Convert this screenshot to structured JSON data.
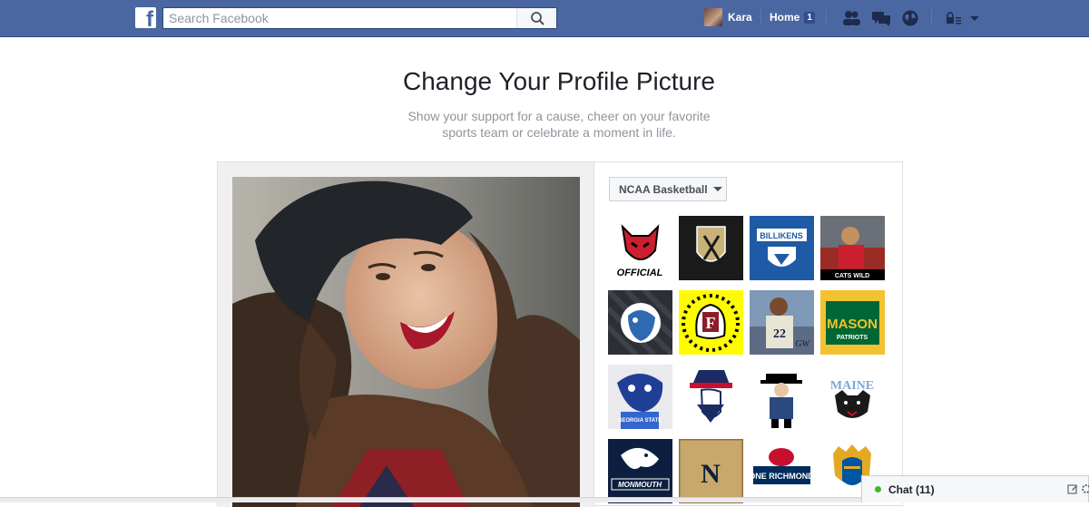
{
  "topbar": {
    "logo_letter": "f",
    "search": {
      "placeholder": "Search Facebook"
    },
    "profile": {
      "name": "Kara"
    },
    "home": {
      "label": "Home",
      "count": "1"
    }
  },
  "page": {
    "title": "Change Your Profile Picture",
    "subtitle_line1": "Show your support for a cause, cheer on your favorite",
    "subtitle_line2": "sports team or celebrate a moment in life."
  },
  "frames": {
    "category": "NCAA Basketball",
    "tiles": [
      {
        "name": "arkansas-state-redwolves",
        "text": "OFFICIAL"
      },
      {
        "name": "army-black-knights",
        "text": ""
      },
      {
        "name": "saint-louis-billikens",
        "text": "BILLIKENS"
      },
      {
        "name": "arizona-wildcat-mascot",
        "text": "CATS WILD"
      },
      {
        "name": "drake-bulldogs",
        "text": ""
      },
      {
        "name": "fordham-snapchat",
        "text": "F"
      },
      {
        "name": "george-washington-player",
        "text": "GW"
      },
      {
        "name": "george-mason-patriots",
        "text": "MASON"
      },
      {
        "name": "georgia-state-mascot",
        "text": "GEORGIA STATE"
      },
      {
        "name": "new-jersey-patriot",
        "text": ""
      },
      {
        "name": "montana-cowboy",
        "text": ""
      },
      {
        "name": "maine-black-bears",
        "text": "MAINE"
      },
      {
        "name": "monmouth-hawks",
        "text": "MONMOUTH"
      },
      {
        "name": "navy-midshipmen",
        "text": "N"
      },
      {
        "name": "richmond-spiders",
        "text": "ONE RICHMOND"
      },
      {
        "name": "san-jose-state-spartans",
        "text": ""
      }
    ]
  },
  "chat": {
    "label": "Chat (11)"
  },
  "colors": {
    "brand": "#4b67a1",
    "chat_online": "#42b72a"
  },
  "icons": [
    "search-icon",
    "friends-icon",
    "messages-icon",
    "globe-icon",
    "privacy-lock-icon",
    "account-caret-icon",
    "compose-icon",
    "settings-gear-icon"
  ]
}
